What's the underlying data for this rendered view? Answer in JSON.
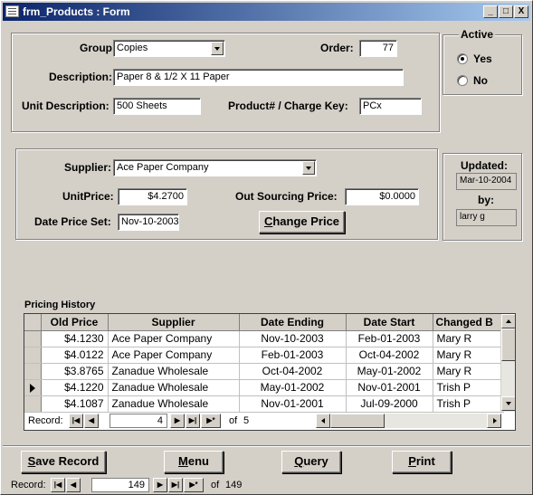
{
  "window": {
    "title": "frm_Products : Form",
    "minimize": "_",
    "maximize": "□",
    "close": "X"
  },
  "product": {
    "group_label": "Group",
    "group_value": "Copies",
    "order_label": "Order:",
    "order_value": "77",
    "description_label": "Description:",
    "description_value": "Paper 8 & 1/2 X 11 Paper",
    "unit_description_label": "Unit Description:",
    "unit_description_value": "500 Sheets",
    "charge_key_label": "Product# / Charge Key:",
    "charge_key_value": "PCx"
  },
  "active": {
    "title": "Active",
    "options": [
      "Yes",
      "No"
    ],
    "selected": "Yes"
  },
  "supplier": {
    "supplier_label": "Supplier:",
    "supplier_value": "Ace Paper Company",
    "unit_price_label": "UnitPrice:",
    "unit_price_value": "$4.2700",
    "out_sourcing_label": "Out Sourcing Price:",
    "out_sourcing_value": "$0.0000",
    "date_price_set_label": "Date Price Set:",
    "date_price_set_value": "Nov-10-2003",
    "change_price_button": "Change Price"
  },
  "updated": {
    "label": "Updated:",
    "date": "Mar-10-2004",
    "by_label": "by:",
    "by_value": "larry g"
  },
  "pricing_history": {
    "title": "Pricing History",
    "columns": [
      "Old Price",
      "Supplier",
      "Date Ending",
      "Date Start",
      "Changed B"
    ],
    "rows": [
      [
        "$4.1230",
        "Ace Paper Company",
        "Nov-10-2003",
        "Feb-01-2003",
        "Mary R"
      ],
      [
        "$4.0122",
        "Ace Paper Company",
        "Feb-01-2003",
        "Oct-04-2002",
        "Mary R"
      ],
      [
        "$3.8765",
        "Zanadue Wholesale",
        "Oct-04-2002",
        "May-01-2002",
        "Mary R"
      ],
      [
        "$4.1220",
        "Zanadue Wholesale",
        "May-01-2002",
        "Nov-01-2001",
        "Trish P"
      ],
      [
        "$4.1087",
        "Zanadue Wholesale",
        "Nov-01-2001",
        "Jul-09-2000",
        "Trish P"
      ]
    ],
    "current_row_index": 3,
    "nav": {
      "label": "Record:",
      "current": "4",
      "of": "of",
      "total": "5"
    }
  },
  "buttons": {
    "save": "Save Record",
    "menu": "Menu",
    "query": "Query",
    "print": "Print"
  },
  "form_nav": {
    "label": "Record:",
    "current": "149",
    "of": "of",
    "total": "149"
  }
}
